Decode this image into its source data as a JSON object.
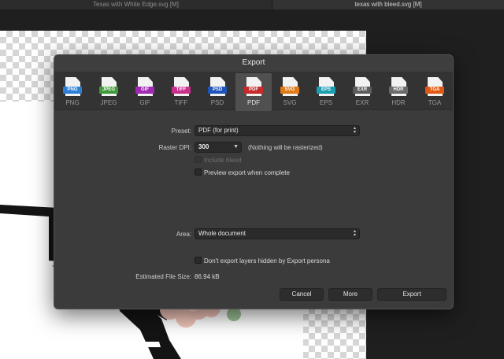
{
  "document_tabs": [
    "Texas with White Edge.svg [M]",
    "texas with bleed.svg [M]"
  ],
  "dialog": {
    "title": "Export",
    "formats": [
      {
        "label": "PNG",
        "badge": "PNG",
        "color": "#2f7fd6"
      },
      {
        "label": "JPEG",
        "badge": "JPEG",
        "color": "#3f9b3a"
      },
      {
        "label": "GIF",
        "badge": "GIF",
        "color": "#a02ab4"
      },
      {
        "label": "TIFF",
        "badge": "TIFF",
        "color": "#c8328c"
      },
      {
        "label": "PSD",
        "badge": "PSD",
        "color": "#1f55b8"
      },
      {
        "label": "PDF",
        "badge": "PDF",
        "color": "#c62a2a"
      },
      {
        "label": "SVG",
        "badge": "SVG",
        "color": "#e07a18"
      },
      {
        "label": "EPS",
        "badge": "EPS",
        "color": "#1c9fb0"
      },
      {
        "label": "EXR",
        "badge": "EXR",
        "color": "#5c5c5c"
      },
      {
        "label": "HDR",
        "badge": "HDR",
        "color": "#6a6a6a"
      },
      {
        "label": "TGA",
        "badge": "TGA",
        "color": "#e05a16"
      }
    ],
    "selected_format": "PDF",
    "preset": {
      "label": "Preset:",
      "value": "PDF (for print)"
    },
    "raster_dpi": {
      "label": "Raster DPI:",
      "value": "300",
      "note": "(Nothing will be rasterized)"
    },
    "include_bleed": {
      "label": "Include bleed",
      "checked": false,
      "enabled": false
    },
    "preview_export": {
      "label": "Preview export when complete",
      "checked": false
    },
    "area": {
      "label": "Area:",
      "value": "Whole document"
    },
    "dont_export_hidden": {
      "label": "Don't export layers hidden by Export persona",
      "checked": false
    },
    "estimated_size": {
      "label": "Estimated File Size:",
      "value": "86.94 kB"
    },
    "buttons": {
      "cancel": "Cancel",
      "more": "More",
      "export": "Export"
    }
  }
}
